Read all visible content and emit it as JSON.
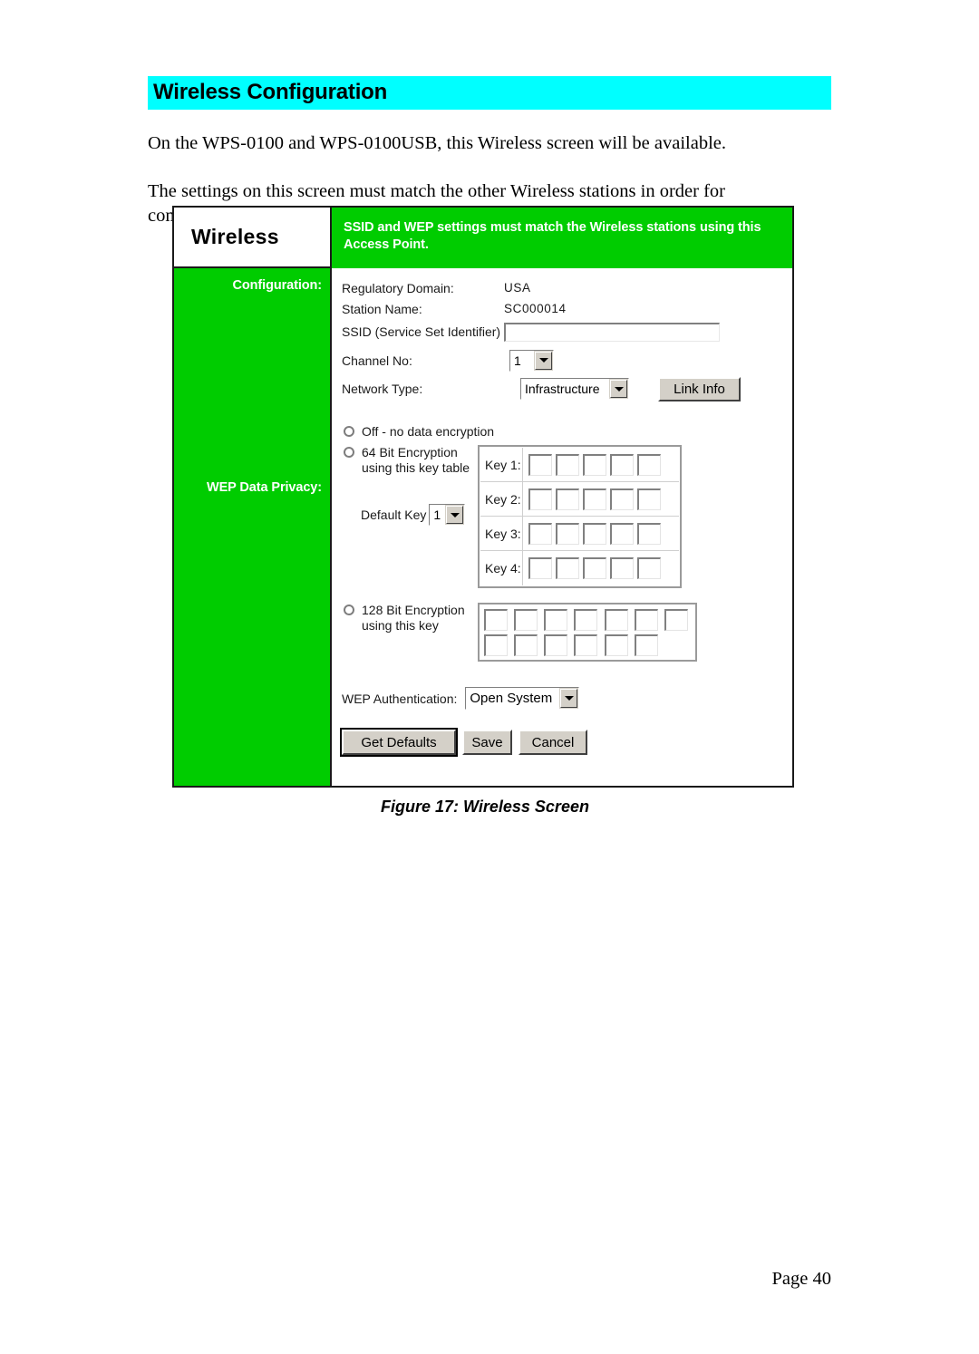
{
  "document": {
    "heading": "Wireless Configuration",
    "paragraph_1": "On the WPS-0100 and WPS-0100USB, this Wireless screen will be available.",
    "paragraph_2": "The settings on this screen must match the other Wireless stations in order for communication to occur.",
    "figure_caption": "Figure 17: Wireless Screen",
    "page_number": "Page 40"
  },
  "colors": {
    "heading_highlight": "#00FFFF",
    "panel_green": "#00CC00",
    "panel_text": "#FFFFFF",
    "button_face": "#D4D0C8"
  },
  "screenshot": {
    "brand": "Wireless",
    "banner": "SSID and WEP settings must match the Wireless stations using this Access Point.",
    "sidebar": {
      "configuration_label": "Configuration:",
      "wep_label": "WEP Data Privacy:"
    },
    "configuration": {
      "regulatory_domain_label": "Regulatory Domain:",
      "regulatory_domain_value": "USA",
      "station_name_label": "Station Name:",
      "station_name_value": "SC000014",
      "ssid_label": "SSID (Service Set Identifier)",
      "ssid_value": "",
      "ssid_placeholder": "",
      "channel_label": "Channel No:",
      "channel_value": "1",
      "channel_options": [
        "1"
      ],
      "network_type_label": "Network Type:",
      "network_type_value": "Infrastructure",
      "network_type_options": [
        "Infrastructure"
      ],
      "link_info_button": "Link Info"
    },
    "wep": {
      "option_off": "Off - no data encryption",
      "option_64_line1": "64 Bit Encryption",
      "option_64_line2": "using this key table",
      "option_128_line1": "128 Bit Encryption",
      "option_128_line2": "using this key",
      "selected_option": "none",
      "default_key_label": "Default Key",
      "default_key_value": "1",
      "default_key_options": [
        "1"
      ],
      "key_rows": [
        {
          "label": "Key 1:",
          "cells": [
            "",
            "",
            "",
            "",
            ""
          ]
        },
        {
          "label": "Key 2:",
          "cells": [
            "",
            "",
            "",
            "",
            ""
          ]
        },
        {
          "label": "Key 3:",
          "cells": [
            "",
            "",
            "",
            "",
            ""
          ]
        },
        {
          "label": "Key 4:",
          "cells": [
            "",
            "",
            "",
            "",
            ""
          ]
        }
      ],
      "key128_cells": [
        "",
        "",
        "",
        "",
        "",
        "",
        "",
        "",
        "",
        "",
        "",
        "",
        ""
      ],
      "authentication_label": "WEP Authentication:",
      "authentication_value": "Open System",
      "authentication_options": [
        "Open System"
      ]
    },
    "buttons": {
      "get_defaults": "Get Defaults",
      "save": "Save",
      "cancel": "Cancel"
    }
  }
}
